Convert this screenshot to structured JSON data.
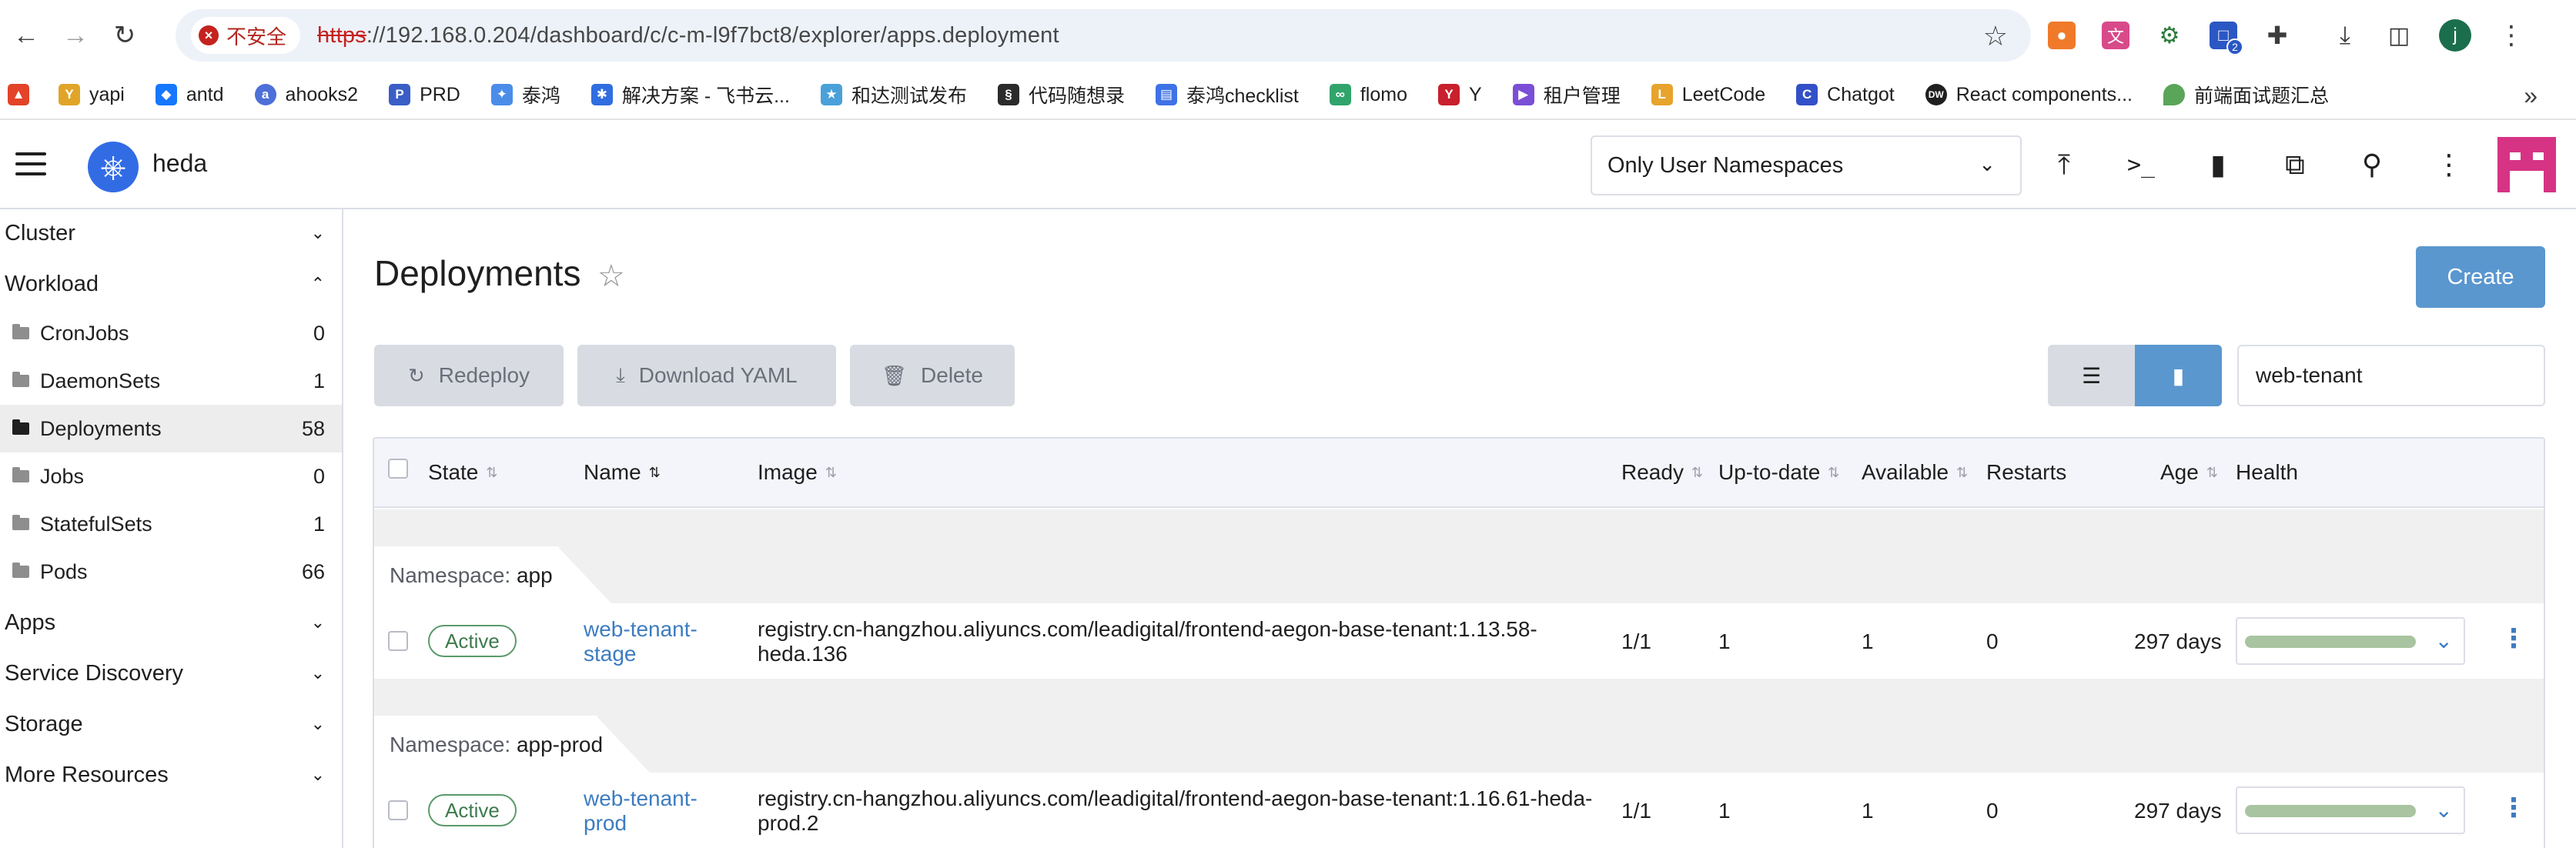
{
  "browser": {
    "insecure_label": "不安全",
    "url_scheme": "https",
    "url_rest": "://192.168.0.204/dashboard/c/c-m-l9f7bct8/explorer/apps.deployment",
    "profile_initial": "j",
    "extension_badge": "2",
    "bookmarks": [
      {
        "label": "yapi",
        "icon": "yapi-icon",
        "color": "#e0a528"
      },
      {
        "label": "antd",
        "icon": "antd-icon",
        "color": "#1677ff"
      },
      {
        "label": "ahooks2",
        "icon": "ahooks-icon",
        "color": "#4d6fd8"
      },
      {
        "label": "PRD",
        "icon": "prd-icon",
        "color": "#3a5ec6"
      },
      {
        "label": "泰鸿",
        "icon": "taihong-icon",
        "color": "#4a8de8"
      },
      {
        "label": "解决方案 - 飞书云...",
        "icon": "feishu-icon",
        "color": "#2f6de0"
      },
      {
        "label": "和达测试发布",
        "icon": "hada-icon",
        "color": "#4aa0d8"
      },
      {
        "label": "代码随想录",
        "icon": "code-icon",
        "color": "#2b2b2b"
      },
      {
        "label": "泰鸿checklist",
        "icon": "doc-icon",
        "color": "#3f72e6"
      },
      {
        "label": "flomo",
        "icon": "flomo-icon",
        "color": "#31a46c"
      },
      {
        "label": "Y",
        "icon": "y-icon",
        "color": "#c8202c"
      },
      {
        "label": "租户管理",
        "icon": "tenant-icon",
        "color": "#7b4ed6"
      },
      {
        "label": "LeetCode",
        "icon": "leetcode-icon",
        "color": "#e7a32c"
      },
      {
        "label": "Chatgot",
        "icon": "chatgot-icon",
        "color": "#3350c8"
      },
      {
        "label": "React components...",
        "icon": "dw-icon",
        "color": "#1f1f1f"
      },
      {
        "label": "前端面试题汇总",
        "icon": "leaf-icon",
        "color": "#5aa55a"
      }
    ]
  },
  "header": {
    "cluster_name": "heda",
    "namespace_filter": "Only User Namespaces"
  },
  "sidebar": {
    "groups": [
      {
        "label": "Cluster",
        "expanded": false
      },
      {
        "label": "Workload",
        "expanded": true
      },
      {
        "label": "Apps",
        "expanded": false
      },
      {
        "label": "Service Discovery",
        "expanded": false
      },
      {
        "label": "Storage",
        "expanded": false
      },
      {
        "label": "More Resources",
        "expanded": false
      }
    ],
    "workload_items": [
      {
        "label": "CronJobs",
        "count": "0"
      },
      {
        "label": "DaemonSets",
        "count": "1"
      },
      {
        "label": "Deployments",
        "count": "58",
        "active": true
      },
      {
        "label": "Jobs",
        "count": "0"
      },
      {
        "label": "StatefulSets",
        "count": "1"
      },
      {
        "label": "Pods",
        "count": "66"
      }
    ]
  },
  "main": {
    "title": "Deployments",
    "create_label": "Create",
    "actions": {
      "redeploy": "Redeploy",
      "download_yaml": "Download YAML",
      "delete": "Delete"
    },
    "search_value": "web-tenant",
    "columns": [
      "State",
      "Name",
      "Image",
      "Ready",
      "Up-to-date",
      "Available",
      "Restarts",
      "Age",
      "Health"
    ],
    "groups": [
      {
        "prefix": "Namespace:",
        "namespace": "app",
        "row": {
          "state": "Active",
          "name_line1": "web-tenant-",
          "name_line2": "stage",
          "image_line1": "registry.cn-hangzhou.aliyuncs.com/leadigital/frontend-aegon-base-tenant:1.13.58-",
          "image_line2": "heda.136",
          "ready": "1/1",
          "up_to_date": "1",
          "available": "1",
          "restarts": "0",
          "age": "297 days",
          "health_fraction": 1.0
        }
      },
      {
        "prefix": "Namespace:",
        "namespace": "app-prod",
        "row": {
          "state": "Active",
          "name_line1": "web-tenant-",
          "name_line2": "prod",
          "image_line1": "registry.cn-hangzhou.aliyuncs.com/leadigital/frontend-aegon-base-tenant:1.16.61-heda-",
          "image_line2": "prod.2",
          "ready": "1/1",
          "up_to_date": "1",
          "available": "1",
          "restarts": "0",
          "age": "297 days",
          "health_fraction": 1.0
        }
      }
    ]
  },
  "colors": {
    "accent": "#5a97cf",
    "link": "#3d7cc0",
    "active_badge": "#5a9a6a",
    "health_bar": "#a8c4a0",
    "brand": "#d63384"
  }
}
